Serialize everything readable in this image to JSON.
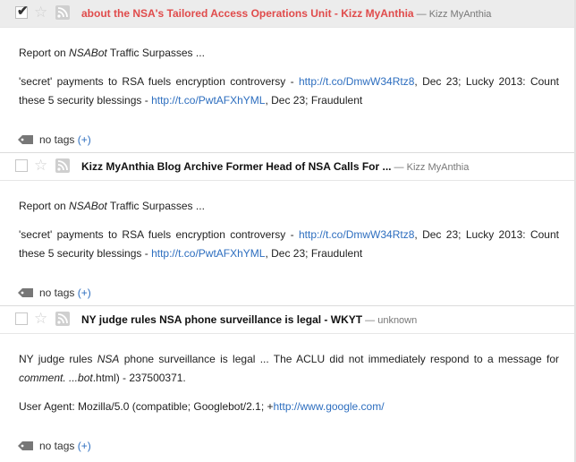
{
  "items": [
    {
      "title": "about the NSA's Tailored Access Operations Unit - Kizz MyAnthia",
      "source": "Kizz MyAnthia",
      "summary_text": "Traffic Surpasses ...",
      "summary_prefix": "Report on ",
      "summary_em": "NSABot",
      "body_text_1": "'secret' payments to RSA fuels encryption controversy - ",
      "link_1": "http://t.co/DmwW34Rtz8",
      "body_text_2": ", Dec 23; Lucky 2013: Count these 5 security blessings - ",
      "link_2": "http://t.co/PwtAFXhYML",
      "body_text_3": ", Dec 23; Fraudulent",
      "tags_label": "no tags",
      "tags_add": "(+)"
    },
    {
      "title": "Kizz MyAnthia Blog Archive Former Head of NSA Calls For ...",
      "source": "Kizz MyAnthia",
      "summary_prefix": "Report on ",
      "summary_em": "NSABot",
      "summary_text": "Traffic Surpasses ...",
      "body_text_1": "'secret' payments to RSA fuels encryption controversy - ",
      "link_1": "http://t.co/DmwW34Rtz8",
      "body_text_2": ", Dec 23; Lucky 2013: Count these 5 security blessings - ",
      "link_2": "http://t.co/PwtAFXhYML",
      "body_text_3": ", Dec 23; Fraudulent",
      "tags_label": "no tags",
      "tags_add": "(+)"
    },
    {
      "title": "NY judge rules NSA phone surveillance is legal - WKYT",
      "source": "unknown",
      "p1_a": "NY judge rules ",
      "p1_em": "NSA",
      "p1_b": " phone surveillance is legal ... The ACLU did not immediately respond to a message for ",
      "p1_em2": "comment. ...bot",
      "p1_c": ".html) - 237500371.",
      "p2_a": "User Agent: Mozilla/5.0 (compatible; Googlebot/2.1; +",
      "p2_link": "http://www.google.com/",
      "tags_label": "no tags",
      "tags_add": "(+)"
    }
  ],
  "dash": " — ",
  "checkmark": "✔",
  "star_glyph": "☆",
  "icons": [
    "check-mark-icon",
    "star-icon",
    "rss-feed-icon",
    "tag-icon"
  ],
  "colors": {
    "read_title": "#e04b4b",
    "link": "#2d6ebf",
    "selected_bg": "#ececec"
  }
}
